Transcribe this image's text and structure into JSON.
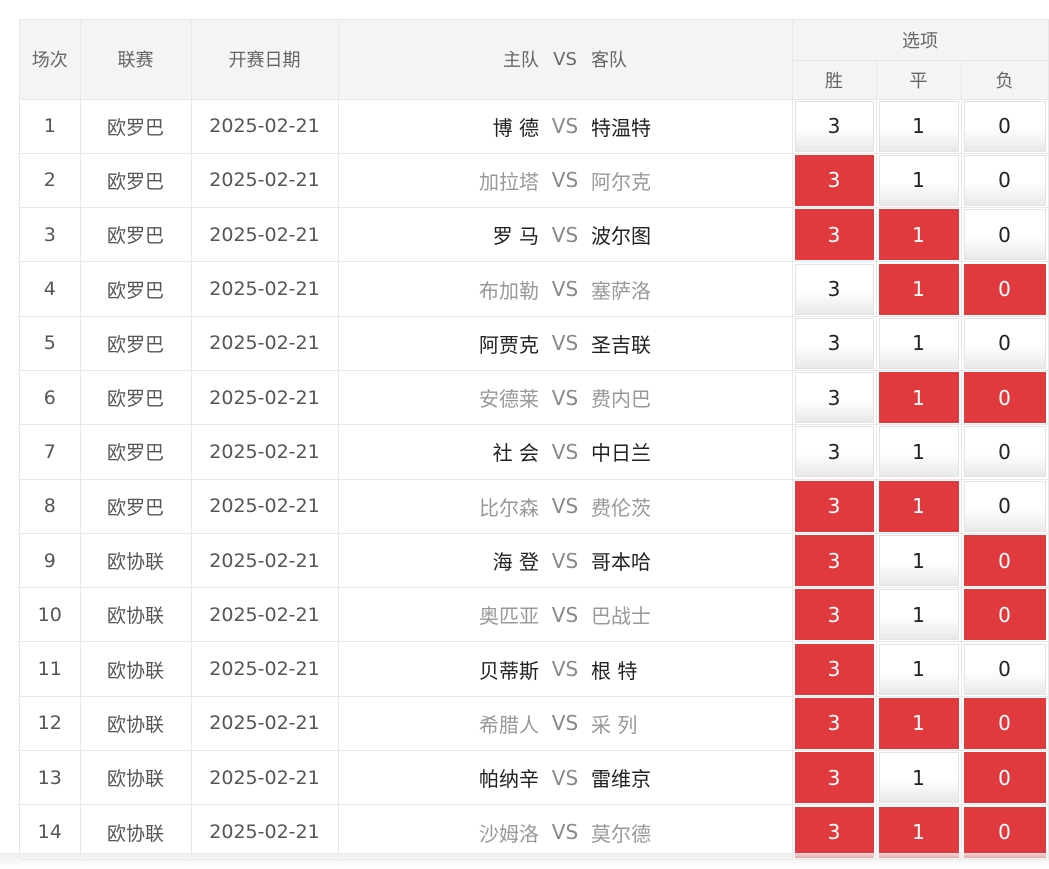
{
  "header": {
    "no": "场次",
    "league": "联赛",
    "date": "开赛日期",
    "match_home": "主队",
    "match_vs": "VS",
    "match_away": "客队",
    "options": "选项",
    "win": "胜",
    "draw": "平",
    "lose": "负"
  },
  "rows": [
    {
      "no": "1",
      "league": "欧罗巴",
      "date": "2025-02-21",
      "home": "博 德",
      "vs": "VS",
      "away": "特温特",
      "win": "3",
      "draw": "1",
      "lose": "0",
      "sel_win": false,
      "sel_draw": false,
      "sel_lose": false
    },
    {
      "no": "2",
      "league": "欧罗巴",
      "date": "2025-02-21",
      "home": "加拉塔",
      "vs": "VS",
      "away": "阿尔克",
      "win": "3",
      "draw": "1",
      "lose": "0",
      "sel_win": true,
      "sel_draw": false,
      "sel_lose": false
    },
    {
      "no": "3",
      "league": "欧罗巴",
      "date": "2025-02-21",
      "home": "罗 马",
      "vs": "VS",
      "away": "波尔图",
      "win": "3",
      "draw": "1",
      "lose": "0",
      "sel_win": true,
      "sel_draw": true,
      "sel_lose": false
    },
    {
      "no": "4",
      "league": "欧罗巴",
      "date": "2025-02-21",
      "home": "布加勒",
      "vs": "VS",
      "away": "塞萨洛",
      "win": "3",
      "draw": "1",
      "lose": "0",
      "sel_win": false,
      "sel_draw": true,
      "sel_lose": true
    },
    {
      "no": "5",
      "league": "欧罗巴",
      "date": "2025-02-21",
      "home": "阿贾克",
      "vs": "VS",
      "away": "圣吉联",
      "win": "3",
      "draw": "1",
      "lose": "0",
      "sel_win": false,
      "sel_draw": false,
      "sel_lose": false
    },
    {
      "no": "6",
      "league": "欧罗巴",
      "date": "2025-02-21",
      "home": "安德莱",
      "vs": "VS",
      "away": "费内巴",
      "win": "3",
      "draw": "1",
      "lose": "0",
      "sel_win": false,
      "sel_draw": true,
      "sel_lose": true
    },
    {
      "no": "7",
      "league": "欧罗巴",
      "date": "2025-02-21",
      "home": "社 会",
      "vs": "VS",
      "away": "中日兰",
      "win": "3",
      "draw": "1",
      "lose": "0",
      "sel_win": false,
      "sel_draw": false,
      "sel_lose": false
    },
    {
      "no": "8",
      "league": "欧罗巴",
      "date": "2025-02-21",
      "home": "比尔森",
      "vs": "VS",
      "away": "费伦茨",
      "win": "3",
      "draw": "1",
      "lose": "0",
      "sel_win": true,
      "sel_draw": true,
      "sel_lose": false
    },
    {
      "no": "9",
      "league": "欧协联",
      "date": "2025-02-21",
      "home": "海 登",
      "vs": "VS",
      "away": "哥本哈",
      "win": "3",
      "draw": "1",
      "lose": "0",
      "sel_win": true,
      "sel_draw": false,
      "sel_lose": true
    },
    {
      "no": "10",
      "league": "欧协联",
      "date": "2025-02-21",
      "home": "奥匹亚",
      "vs": "VS",
      "away": "巴战士",
      "win": "3",
      "draw": "1",
      "lose": "0",
      "sel_win": true,
      "sel_draw": false,
      "sel_lose": true
    },
    {
      "no": "11",
      "league": "欧协联",
      "date": "2025-02-21",
      "home": "贝蒂斯",
      "vs": "VS",
      "away": "根 特",
      "win": "3",
      "draw": "1",
      "lose": "0",
      "sel_win": true,
      "sel_draw": false,
      "sel_lose": false
    },
    {
      "no": "12",
      "league": "欧协联",
      "date": "2025-02-21",
      "home": "希腊人",
      "vs": "VS",
      "away": "采 列",
      "win": "3",
      "draw": "1",
      "lose": "0",
      "sel_win": true,
      "sel_draw": true,
      "sel_lose": true
    },
    {
      "no": "13",
      "league": "欧协联",
      "date": "2025-02-21",
      "home": "帕纳辛",
      "vs": "VS",
      "away": "雷维京",
      "win": "3",
      "draw": "1",
      "lose": "0",
      "sel_win": true,
      "sel_draw": false,
      "sel_lose": true
    },
    {
      "no": "14",
      "league": "欧协联",
      "date": "2025-02-21",
      "home": "沙姆洛",
      "vs": "VS",
      "away": "莫尔德",
      "win": "3",
      "draw": "1",
      "lose": "0",
      "sel_win": true,
      "sel_draw": true,
      "sel_lose": true
    }
  ],
  "colors": {
    "selected": "#e03a3e",
    "header_bg": "#f4f4f4",
    "odd_row_team_text": "#222222",
    "even_row_team_text": "#999999"
  }
}
